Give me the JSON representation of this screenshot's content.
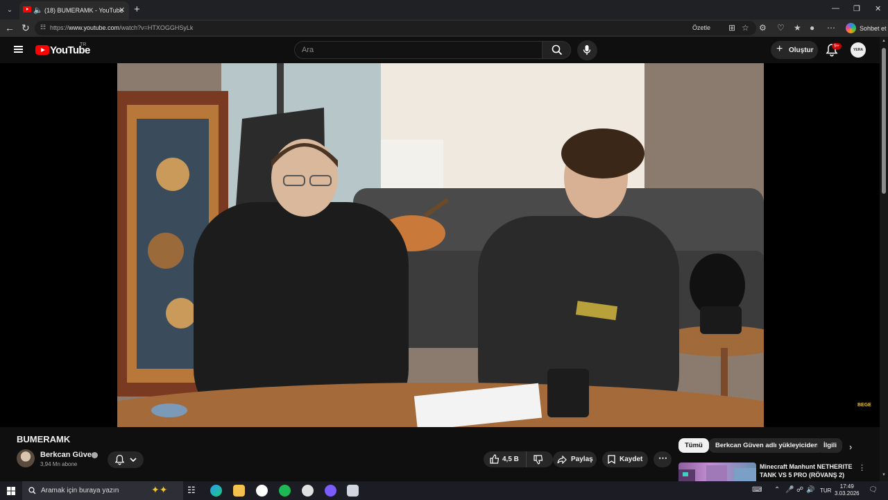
{
  "browser": {
    "tab_title": "(18) BUMERAMK - YouTube",
    "url_prefix": "https://",
    "url_host": "www.youtube.com",
    "url_path": "/watch?v=HTXOGGHSyLk",
    "summarize_label": "Özetle",
    "copilot_label": "Sohbet et"
  },
  "youtube": {
    "logo_text": "YouTube",
    "country_code": "TR",
    "search_placeholder": "Ara",
    "create_label": "Oluştur",
    "notif_count": "9+",
    "avatar_text": "YERA",
    "video_watermark": "BEGE"
  },
  "video": {
    "title": "BUMERAMK",
    "channel_name": "Berkcan Güven",
    "subscribers": "3,94 Mn abone",
    "likes": "4,5 B",
    "share_label": "Paylaş",
    "save_label": "Kaydet"
  },
  "chips": {
    "all": "Tümü",
    "channel": "Berkcan Güven adlı yükleyiciden",
    "related": "İlgili"
  },
  "recommendation": {
    "title": "Minecraft Manhunt NETHERITE TANK VS 5 PRO (RÖVANŞ 2)"
  },
  "taskbar": {
    "search_placeholder": "Aramak için buraya yazın",
    "lang": "TUR",
    "time": "17:49",
    "date": "3.03.2026"
  },
  "colors": {
    "youtube_red": "#ff0000",
    "background": "#0f0f0f",
    "chip_active": "#f1f1f1"
  }
}
